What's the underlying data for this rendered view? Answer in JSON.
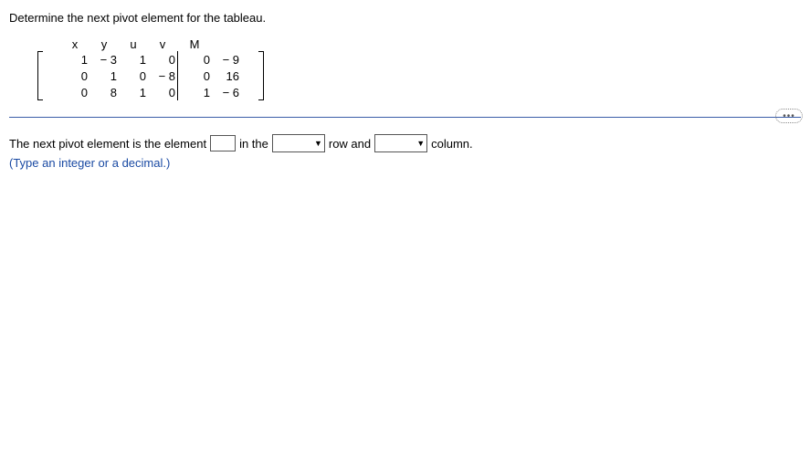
{
  "question": "Determine the next pivot element for the tableau.",
  "tableau": {
    "headers": [
      "x",
      "y",
      "u",
      "v",
      "M",
      ""
    ],
    "rows": [
      [
        "1",
        "− 3",
        "1",
        "0",
        "0",
        "− 9"
      ],
      [
        "0",
        "1",
        "0",
        "− 8",
        "0",
        "16"
      ],
      [
        "0",
        "8",
        "1",
        "0",
        "1",
        "− 6"
      ]
    ]
  },
  "answer": {
    "prefix": "The next pivot element is the element",
    "mid1": "in the",
    "mid2": "row and",
    "suffix": "column."
  },
  "hint": "(Type an integer or a decimal.)",
  "pill": "•••"
}
